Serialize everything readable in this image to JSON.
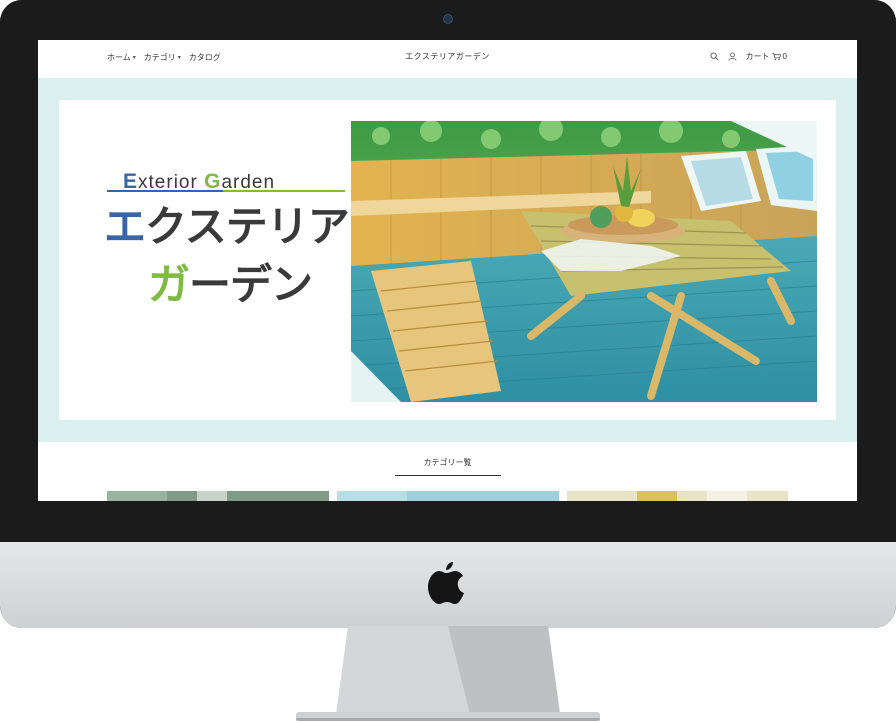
{
  "header": {
    "nav": [
      {
        "label": "ホーム",
        "has_dropdown": true
      },
      {
        "label": "カテゴリ",
        "has_dropdown": true
      },
      {
        "label": "カタログ",
        "has_dropdown": false
      }
    ],
    "site_title": "エクステリアガーデン",
    "icons": [
      "search-icon",
      "user-icon",
      "cart-icon"
    ],
    "cart_label": "カート",
    "cart_count": "0"
  },
  "hero": {
    "logo_en_first_initial": "E",
    "logo_en_first_rest": "xterior ",
    "logo_en_second_initial": "G",
    "logo_en_second_rest": "arden",
    "logo_jp_line1_first": "エ",
    "logo_jp_line1_rest": "クステリア",
    "logo_jp_line2_first": "ガ",
    "logo_jp_line2_rest": "ーデン",
    "photo_icon": "wooden-deck-photo"
  },
  "categories": {
    "title": "カテゴリー覧"
  },
  "device": {
    "brand_icon": "apple-logo-icon"
  },
  "colors": {
    "brand_blue": "#3a64a8",
    "brand_green": "#7dbb43",
    "hero_band": "#dcefef"
  }
}
